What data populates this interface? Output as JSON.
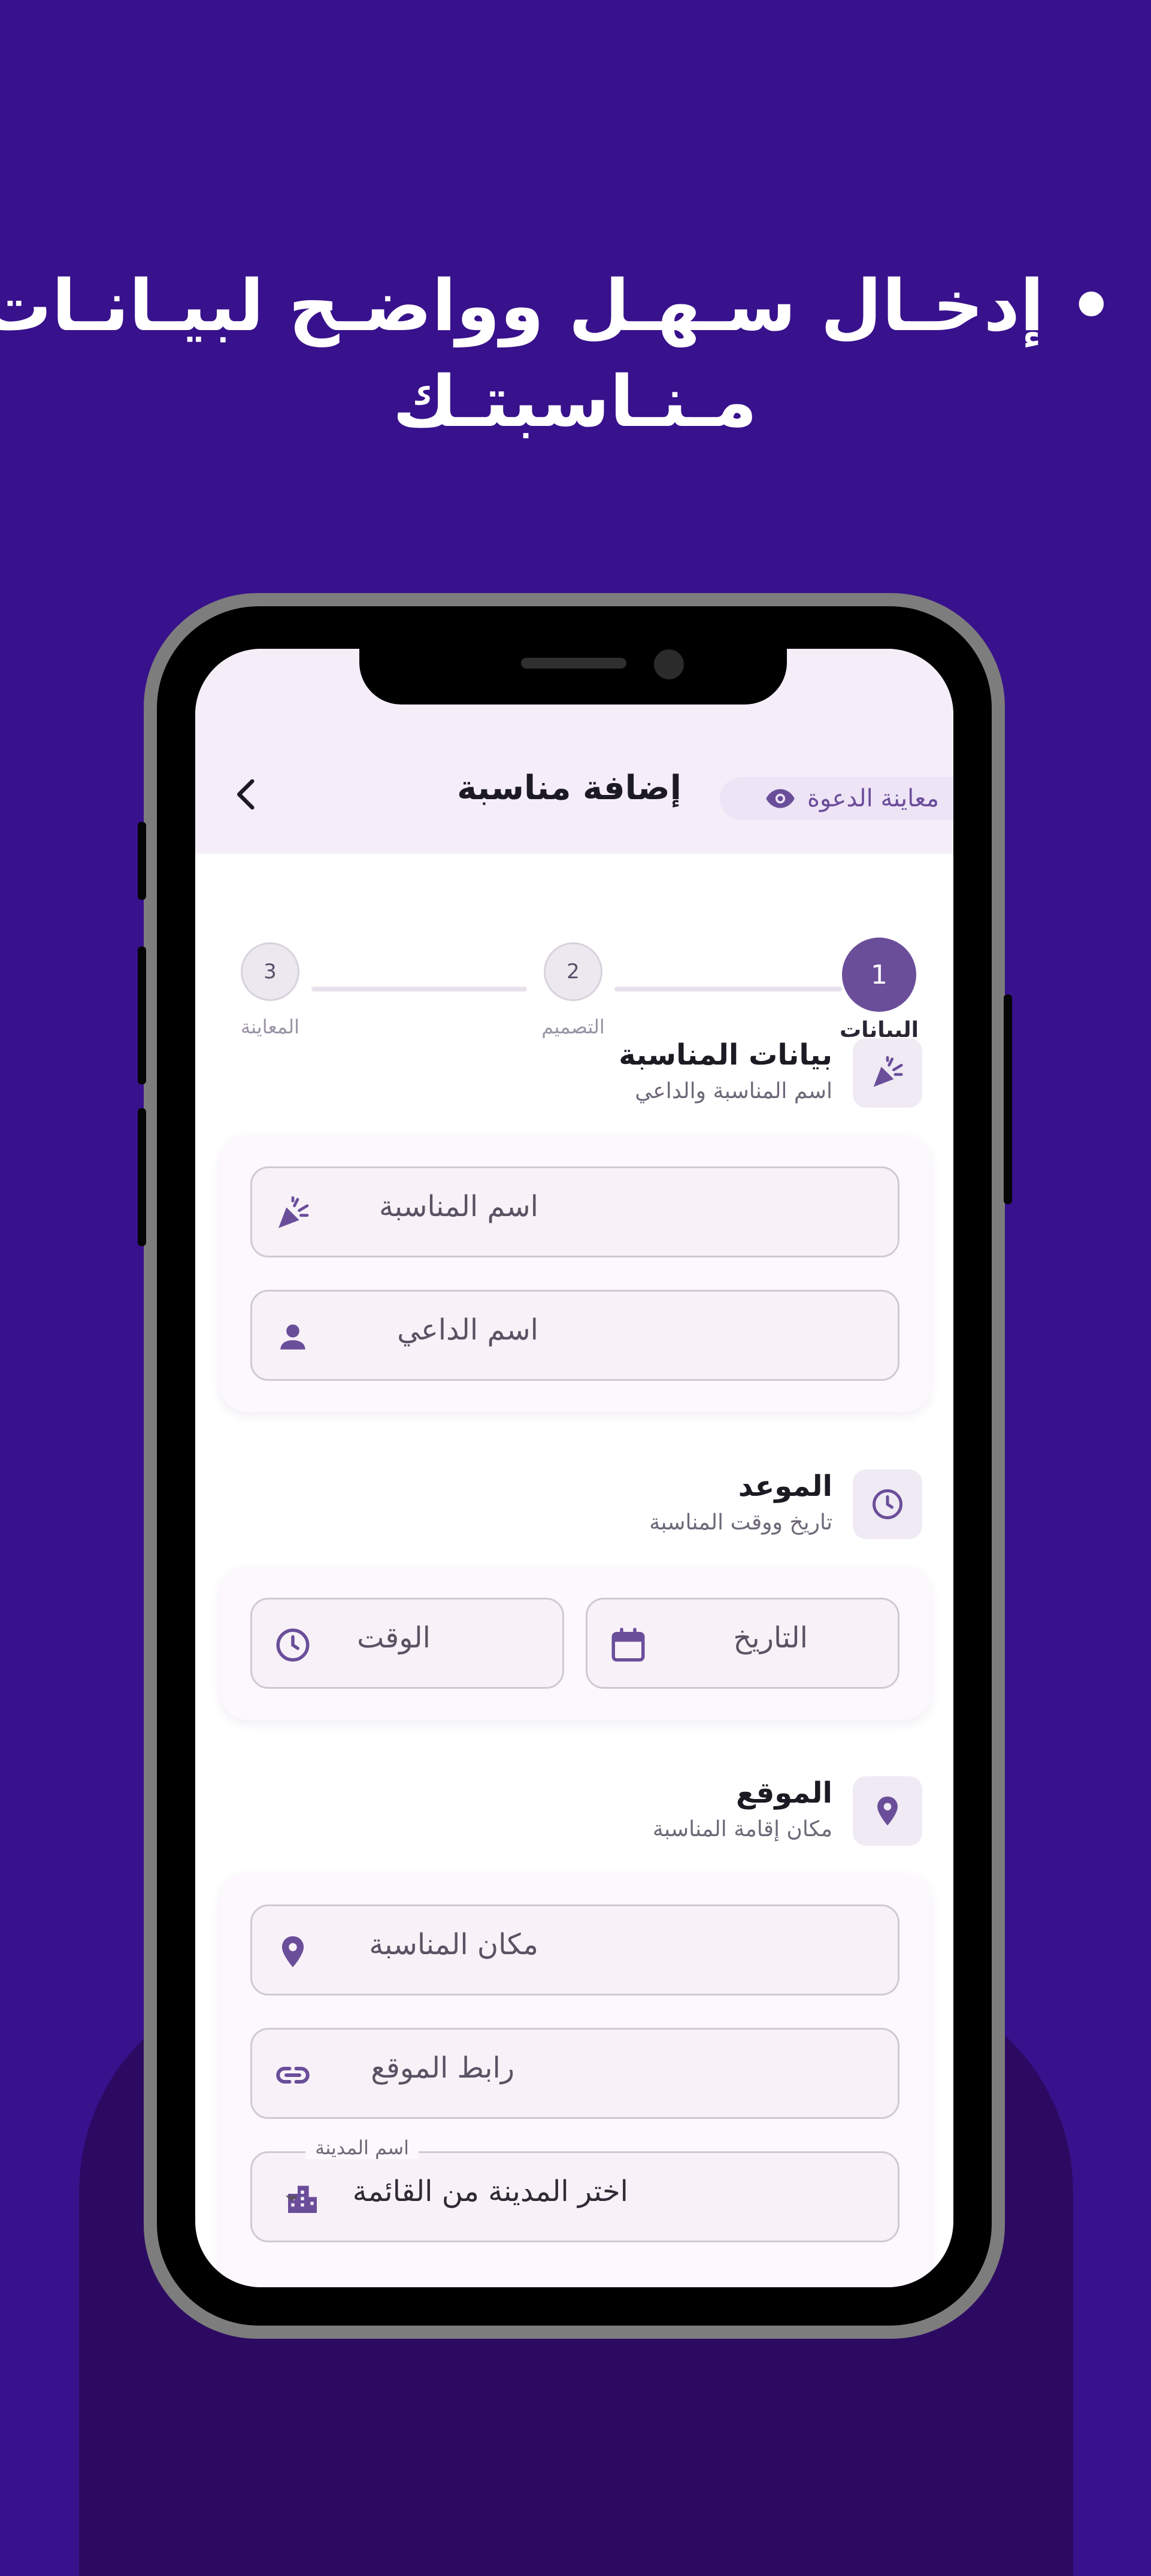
{
  "promo": {
    "headline_line1": "• إدخـال سـهـل وواضـح لبيـانـات",
    "headline_line2": "مـنـاسبتـك"
  },
  "appbar": {
    "title": "إضافة مناسبة",
    "preview_label": "معاينة الدعوة",
    "back_icon": "chevron-left-icon",
    "preview_icon": "eye-icon"
  },
  "stepper": {
    "steps": [
      {
        "number": "1",
        "label": "البيانات",
        "active": true
      },
      {
        "number": "2",
        "label": "التصميم",
        "active": false
      },
      {
        "number": "3",
        "label": "المعاينة",
        "active": false
      }
    ]
  },
  "sections": {
    "event": {
      "title": "بيانات المناسبة",
      "subtitle": "اسم المناسبة والداعي",
      "icon": "party-popper-icon",
      "fields": {
        "event_name_placeholder": "اسم المناسبة",
        "host_name_placeholder": "اسم الداعي"
      }
    },
    "schedule": {
      "title": "الموعد",
      "subtitle": "تاريخ ووقت المناسبة",
      "icon": "clock-icon",
      "fields": {
        "date_placeholder": "التاريخ",
        "time_placeholder": "الوقت"
      }
    },
    "location": {
      "title": "الموقع",
      "subtitle": "مكان إقامة المناسبة",
      "icon": "location-pin-icon",
      "fields": {
        "venue_placeholder": "مكان المناسبة",
        "link_placeholder": "رابط الموقع",
        "city_label": "اسم المدينة",
        "city_value": "اختر المدينة من القائمة"
      }
    }
  },
  "colors": {
    "background": "#38118c",
    "accent": "#6b4e9a",
    "appbar": "#f5eef9"
  }
}
